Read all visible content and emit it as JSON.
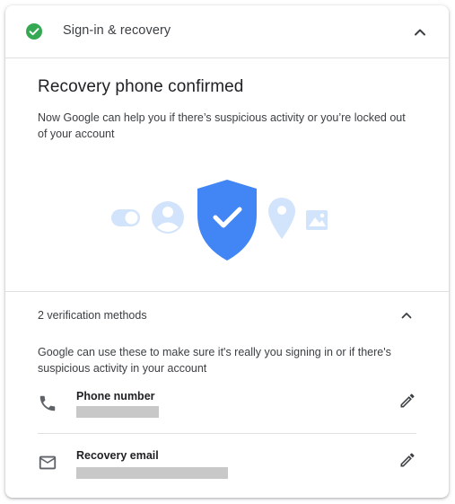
{
  "header": {
    "title": "Sign-in & recovery",
    "status_icon": "check-circle-icon",
    "collapse_icon": "chevron-up-icon"
  },
  "confirmation": {
    "title": "Recovery phone confirmed",
    "description": "Now Google can help you if there’s suspicious activity or you’re locked out of your account"
  },
  "methods": {
    "header": "2 verification methods",
    "description": "Google can use these to make sure it's really you signing in or if there's suspicious activity in your account",
    "items": [
      {
        "label": "Phone number",
        "icon": "phone-icon",
        "action_icon": "edit-pencil-icon"
      },
      {
        "label": "Recovery email",
        "icon": "mail-icon",
        "action_icon": "edit-pencil-icon"
      }
    ]
  },
  "colors": {
    "success_green": "#34a853",
    "shield_blue": "#4285f4",
    "light_blue": "#d2e3fc"
  }
}
